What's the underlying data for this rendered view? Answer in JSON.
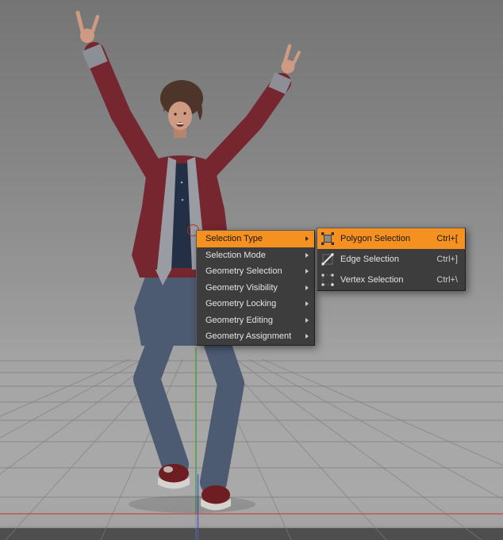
{
  "colors": {
    "accent_orange": "#f59120",
    "menu_bg": "#3d3d3d",
    "menu_text": "#e4e4e4",
    "highlight_text": "#161616",
    "axis_red": "#c24a44",
    "axis_green": "#3f9b3f",
    "axis_blue": "#4a57c8"
  },
  "context_menu": {
    "items": [
      {
        "label": "Selection Type",
        "highlighted": true,
        "has_submenu": true
      },
      {
        "label": "Selection Mode",
        "highlighted": false,
        "has_submenu": true
      },
      {
        "label": "Geometry Selection",
        "highlighted": false,
        "has_submenu": true
      },
      {
        "label": "Geometry Visibility",
        "highlighted": false,
        "has_submenu": true
      },
      {
        "label": "Geometry Locking",
        "highlighted": false,
        "has_submenu": true
      },
      {
        "label": "Geometry Editing",
        "highlighted": false,
        "has_submenu": true
      },
      {
        "label": "Geometry Assignment",
        "highlighted": false,
        "has_submenu": true
      }
    ]
  },
  "submenu": {
    "items": [
      {
        "label": "Polygon Selection",
        "shortcut": "Ctrl+[",
        "icon": "polygon-selection-icon",
        "highlighted": true
      },
      {
        "label": "Edge Selection",
        "shortcut": "Ctrl+]",
        "icon": "edge-selection-icon",
        "highlighted": false
      },
      {
        "label": "Vertex Selection",
        "shortcut": "Ctrl+\\",
        "icon": "vertex-selection-icon",
        "highlighted": false
      }
    ]
  }
}
